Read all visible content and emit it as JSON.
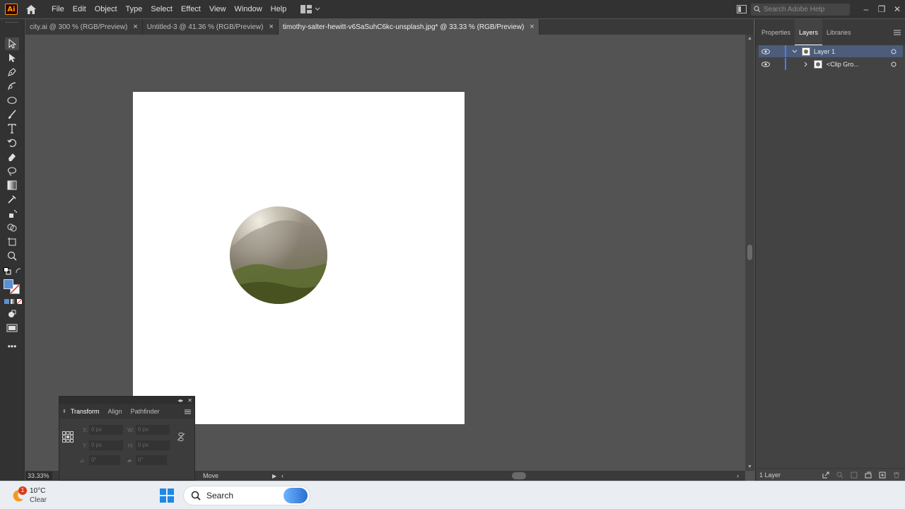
{
  "app": {
    "logo_text": "Ai",
    "menu": [
      "File",
      "Edit",
      "Object",
      "Type",
      "Select",
      "Effect",
      "View",
      "Window",
      "Help"
    ],
    "search_placeholder": "Search Adobe Help"
  },
  "tabs": [
    {
      "label": "city.ai @ 300 % (RGB/Preview)",
      "close": "×",
      "active": false
    },
    {
      "label": "Untitled-3 @ 41.36 % (RGB/Preview)",
      "close": "×",
      "active": false
    },
    {
      "label": "timothy-salter-hewitt-v6SaSuhC6kc-unsplash.jpg* @ 33.33 % (RGB/Preview)",
      "close": "×",
      "active": true
    }
  ],
  "status": {
    "zoom": "33.33%",
    "tool_label": "Move"
  },
  "right_panel": {
    "tabs": [
      "Properties",
      "Layers",
      "Libraries"
    ],
    "active_tab": "Layers",
    "layers": [
      {
        "name": "Layer 1",
        "selected": true
      },
      {
        "name": "<Clip Gro...",
        "selected": false
      }
    ],
    "footer_count": "1 Layer"
  },
  "transform_panel": {
    "tabs": [
      "Transform",
      "Align",
      "Pathfinder"
    ],
    "x_label": "X:",
    "x_value": "0 px",
    "y_label": "Y:",
    "y_value": "0 px",
    "w_label": "W:",
    "w_value": "0 px",
    "h_label": "H:",
    "h_value": "0 px",
    "angle_value": "0°",
    "shear_value": "0°"
  },
  "taskbar": {
    "temperature": "10°C",
    "condition": "Clear",
    "badge": "1",
    "search_label": "Search"
  },
  "colors": {
    "accent_layer": "#4c5c7a",
    "layer_color_bar": "#4a7dff",
    "fill_swatch": "#5b8fd6"
  }
}
